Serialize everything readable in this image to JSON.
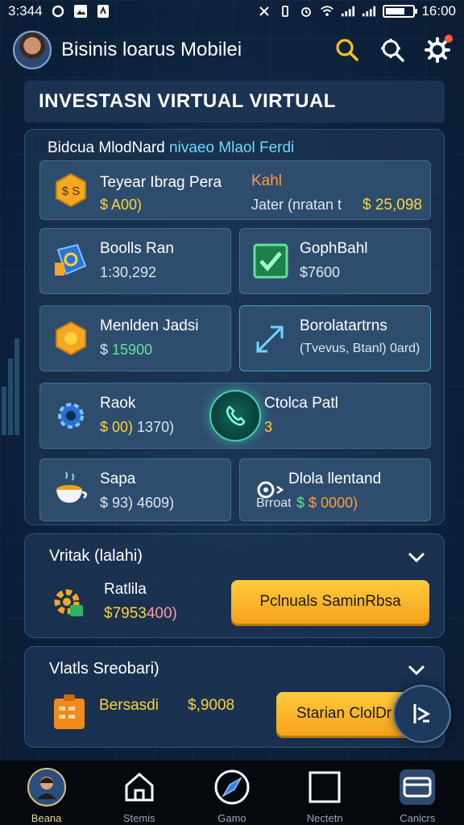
{
  "status_bar": {
    "time": "3:344",
    "clock": "16:00",
    "battery_level": 0.7
  },
  "header": {
    "title": "Bisinis loarus Mobilei",
    "icons": [
      "search-icon",
      "settings-search-icon",
      "gear-icon"
    ]
  },
  "page_title": "INVESTASN VIRTUAL VIRTUAL",
  "panel": {
    "heading_part1": "Bidcua MlodNard ",
    "heading_part2": "nivaeo Mlaol Ferdi",
    "cards": [
      {
        "title": "Teyear Ibrag Pera",
        "value": "$ A00)",
        "side_title": "Kahl",
        "side_label": "Jater (nratan t",
        "side_value": "$ 25,098",
        "icon": "coin-box-icon"
      },
      {
        "title": "Boolls Ran",
        "value": "1:30,292",
        "icon": "shield-coin-icon"
      },
      {
        "title": "GophBahl",
        "value": "$7600",
        "icon": "checkbox-icon"
      },
      {
        "title": "Menlden Jadsi",
        "value_prefix": "$",
        "value": "15900",
        "icon": "coin-hex-icon"
      },
      {
        "title": "Borolatartrns",
        "value": "(Tvevus, Btanl) 0ard)",
        "icon": "arrow-icon"
      },
      {
        "title": "Raok",
        "value_money": "$ 00)",
        "value_rest": "1370)",
        "icon": "gear-chip-icon"
      },
      {
        "title": "Ctolca Patl",
        "value": "3",
        "icon": "phone-icon"
      },
      {
        "title": "Sapa",
        "value": "$ 93) 4609)",
        "icon": "coffee-cup-icon"
      },
      {
        "title": "Dlola llentand",
        "label": "Brroat",
        "value": "$ 0000)",
        "icon": "gear-arrow-icon"
      }
    ]
  },
  "accordion_1": {
    "title": "Vritak (lalahi)",
    "item_title": "Ratlila",
    "item_value_money": "$7953",
    "item_value_rest": "400)",
    "button": "Pclnuals SaminRbsa",
    "icon": "gear-coin-icon"
  },
  "accordion_2": {
    "title": "Vlatls Sreobari)",
    "item_label": "Bersasdi",
    "item_value": "$,9008",
    "button": "Starian ClolDr",
    "icon": "orange-box-icon"
  },
  "fab_icon": "exit-arrow-icon",
  "bottom_nav": [
    {
      "label": "Beana",
      "icon": "avatar-icon"
    },
    {
      "label": "Stemis",
      "icon": "house-icon"
    },
    {
      "label": "Gamo",
      "icon": "compass-icon"
    },
    {
      "label": "Nectetn",
      "icon": "square-icon"
    },
    {
      "label": "Canicrs",
      "icon": "card-icon"
    }
  ],
  "colors": {
    "accent": "#ffd23a",
    "button": "#f5a21c",
    "green": "#63e39a",
    "background": "#0f2440"
  }
}
